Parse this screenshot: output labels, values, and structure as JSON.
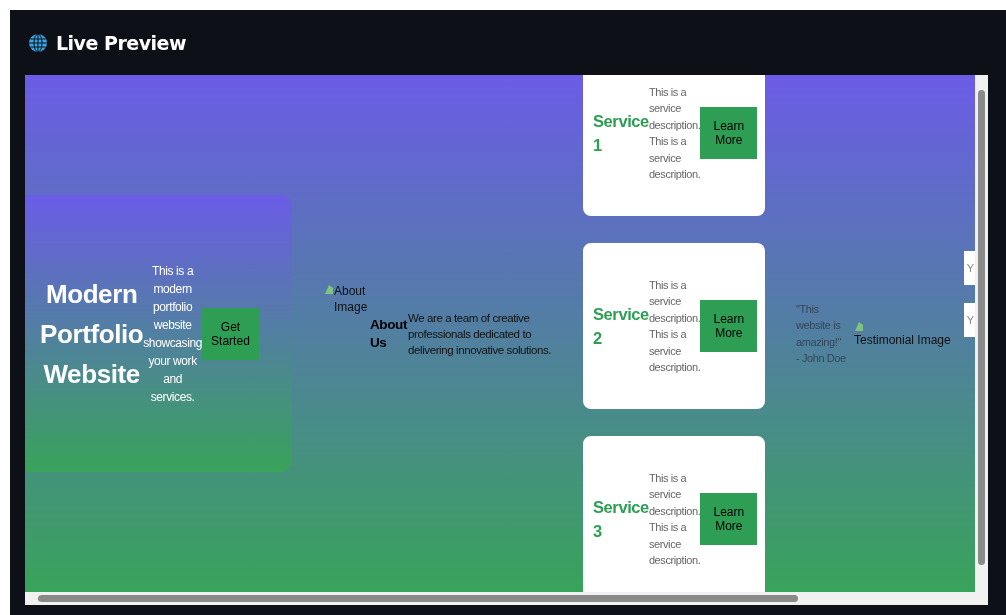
{
  "window": {
    "title": "Live Preview"
  },
  "hero": {
    "title": "Modern Portfolio Website",
    "description": "This is a modern portfolio website showcasing your work and services.",
    "button": "Get Started"
  },
  "about": {
    "image_alt": "About Image",
    "heading": "About Us",
    "text": "We are a team of creative professionals dedicated to delivering innovative solutions."
  },
  "services": [
    {
      "title": "Service 1",
      "description": "This is a service description. This is a service description.",
      "button": "Learn More"
    },
    {
      "title": "Service 2",
      "description": "This is a service description. This is a service description.",
      "button": "Learn More"
    },
    {
      "title": "Service 3",
      "description": "This is a service description. This is a service description.",
      "button": "Learn More"
    }
  ],
  "testimonial": {
    "quote": "\"This website is amazing!\" - John Doe",
    "image_alt": "Testimonial Image"
  },
  "cut_cards": [
    "Y",
    "Y"
  ]
}
